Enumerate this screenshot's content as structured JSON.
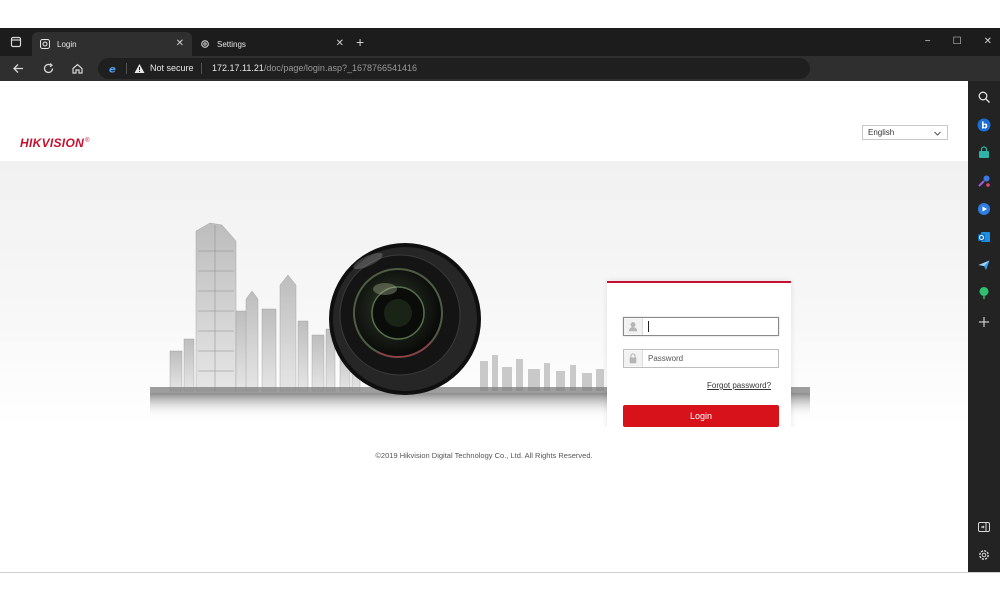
{
  "browser": {
    "tabs": [
      {
        "label": "Login",
        "active": true
      },
      {
        "label": "Settings",
        "active": false
      }
    ],
    "new_tab_glyph": "+",
    "window_controls": [
      "−",
      "☐",
      "✕"
    ],
    "address": {
      "security_label": "Not secure",
      "url_host": "172.17.11.21",
      "url_path": "/doc/page/login.asp?_1678766541416"
    },
    "nav_icons": [
      "back-arrow-icon",
      "refresh-icon",
      "home-icon"
    ],
    "toolbar_icons": [
      "add-favorite-icon",
      "extensions-icon",
      "favorites-icon",
      "collections-icon",
      "browser-essentials-icon",
      "profile-icon"
    ],
    "sidebar_icons": [
      "search-icon",
      "bing-icon",
      "shopping-icon",
      "tools-icon",
      "games-icon",
      "outlook-icon",
      "send-icon",
      "tree-icon",
      "add-icon",
      "split-screen-icon",
      "settings-icon"
    ],
    "accent_profile": "#e2231a"
  },
  "page": {
    "logo": "HIKVISION",
    "logo_mark": "®",
    "language": "English",
    "login": {
      "username_value": "",
      "password_placeholder": "Password",
      "forgot_label": "Forgot password?",
      "login_button": "Login"
    },
    "copyright": "©2019 Hikvision Digital Technology Co., Ltd. All Rights Reserved.",
    "brand_color": "#c8102e",
    "button_color": "#d8121a"
  }
}
